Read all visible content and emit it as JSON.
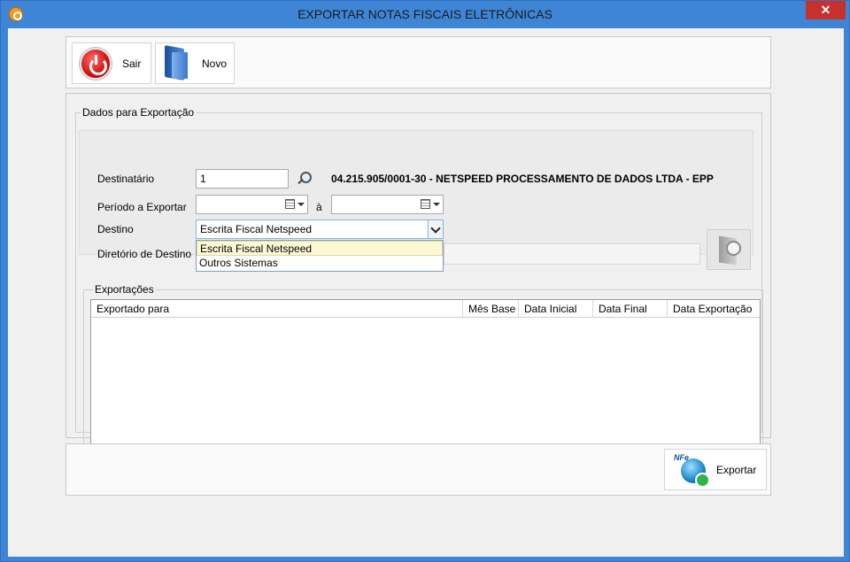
{
  "window": {
    "title": "EXPORTAR NOTAS FISCAIS ELETRÔNICAS",
    "close_label": "✕"
  },
  "toolbar": {
    "sair_label": "Sair",
    "novo_label": "Novo"
  },
  "form": {
    "group_label": "Dados para Exportação",
    "destinatario_label": "Destinatário",
    "destinatario_value": "1",
    "destinatario_info": "04.215.905/0001-30 - NETSPEED PROCESSAMENTO DE DADOS LTDA - EPP",
    "periodo_label": "Período a Exportar",
    "periodo_start": "",
    "periodo_sep": "à",
    "periodo_end": "",
    "destino_label": "Destino",
    "destino_value": "Escrita Fiscal Netspeed",
    "destino_options": [
      "Escrita Fiscal Netspeed",
      "Outros Sistemas"
    ],
    "diretorio_label": "Diretório de Destino",
    "diretorio_value": ""
  },
  "exports": {
    "group_label": "Exportações",
    "columns": [
      "Exportado para",
      "Mês Base",
      "Data Inicial",
      "Data Final",
      "Data Exportação"
    ],
    "rows": []
  },
  "footer": {
    "exportar_label": "Exportar",
    "nfe_badge": "NFe"
  },
  "colors": {
    "title_bar": "#3f85d6",
    "close_button": "#c7312b",
    "dropdown_highlight": "#fdf8d4"
  }
}
